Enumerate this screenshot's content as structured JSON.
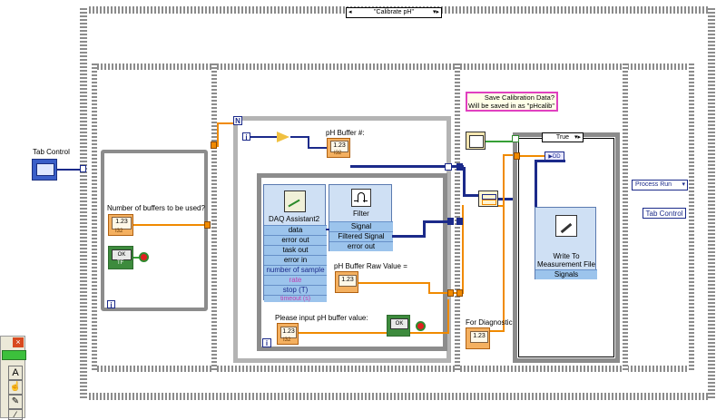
{
  "case_selector": {
    "value": "\"Calibrate pH\""
  },
  "tab_control_label": "Tab Control",
  "buffers_label": "Number of buffers to be used?",
  "numeric_text": "1.23",
  "numeric_type": "I32",
  "ok_label": "OK",
  "tf_label": "TF",
  "info_glyph": "i",
  "n_glyph": "N",
  "ph_buffer_label": "pH Buffer #:",
  "save_comment": [
    "Save Calibration Data?",
    "Will be saved in as \"pHcalib\""
  ],
  "daq": {
    "title": "DAQ Assistant2",
    "items": [
      "data",
      "error out",
      "task out",
      "error in",
      "number of sample",
      "rate",
      "stop (T)",
      "timeout (s)"
    ]
  },
  "filter": {
    "title": "Filter",
    "items": [
      "Signal",
      "Filtered Signal",
      "error out"
    ]
  },
  "raw_value_label": "pH Buffer Raw Value =",
  "input_label": "Please input pH buffer value:",
  "diagnostics_label": "For Diagnostics",
  "true_case": {
    "value": "True"
  },
  "write_file": {
    "title_lines": [
      "Write To",
      "Measurement File"
    ],
    "items": [
      "Signals"
    ]
  },
  "process_run": {
    "value": "Process Run"
  },
  "tab_control_ref": "Tab Control",
  "colors": {
    "wire_orange": "#f08a00",
    "wire_blue": "#1b2a8a",
    "wire_green": "#36a036",
    "comment_border": "#e040c0"
  }
}
